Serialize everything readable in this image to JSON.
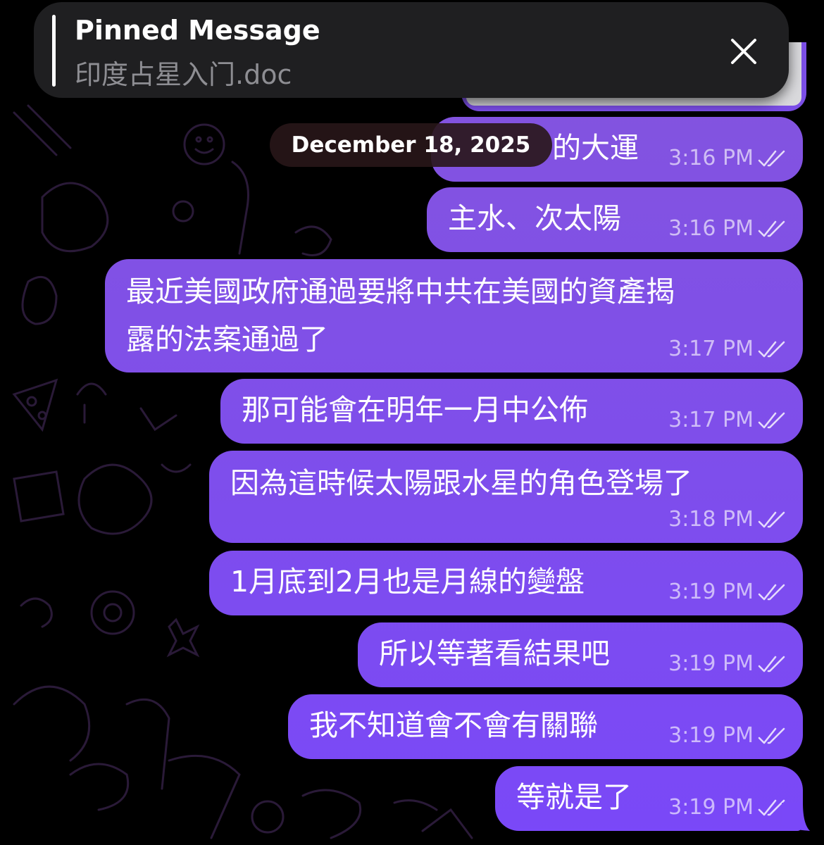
{
  "colors": {
    "bubble_top": "#8455dc",
    "bubble_bottom": "#7a48f8",
    "pinned_bg": "#1f1f21",
    "date_pill_bg": "#281618"
  },
  "pinned": {
    "title": "Pinned Message",
    "subtitle": "印度占星入门.doc",
    "close_icon": "close-icon"
  },
  "date_label": "December 18, 2025",
  "messages": [
    {
      "text": "的大運",
      "time": "3:16 PM",
      "status_icon": "double-check-icon"
    },
    {
      "text": "主水、次太陽",
      "time": "3:16 PM",
      "status_icon": "double-check-icon"
    },
    {
      "line1": "最近美國政府通過要將中共在美國的資產揭",
      "line2": "露的法案通過了",
      "time": "3:17 PM",
      "status_icon": "double-check-icon"
    },
    {
      "text": "那可能會在明年一月中公佈",
      "time": "3:17 PM",
      "status_icon": "double-check-icon"
    },
    {
      "text": "因為這時候太陽跟水星的角色登場了",
      "time": "3:18 PM",
      "status_icon": "double-check-icon"
    },
    {
      "text": "1月底到2月也是月線的變盤",
      "time": "3:19 PM",
      "status_icon": "double-check-icon"
    },
    {
      "text": "所以等著看結果吧",
      "time": "3:19 PM",
      "status_icon": "double-check-icon"
    },
    {
      "text": "我不知道會不會有關聯",
      "time": "3:19 PM",
      "status_icon": "double-check-icon"
    },
    {
      "text": "等就是了",
      "time": "3:19 PM",
      "status_icon": "double-check-icon"
    }
  ]
}
